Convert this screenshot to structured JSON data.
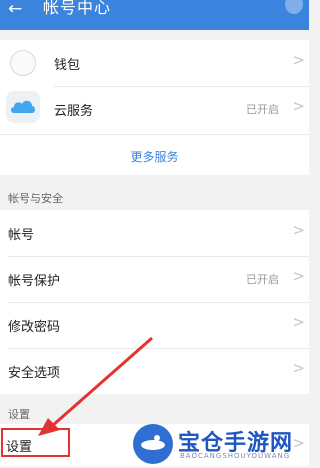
{
  "header": {
    "back_icon": "←",
    "title": "帐号中心"
  },
  "services": {
    "items": [
      {
        "label": "钱包",
        "status": "",
        "icon": "wallet-icon"
      },
      {
        "label": "云服务",
        "status": "已开启",
        "icon": "cloud-icon"
      }
    ],
    "more_label": "更多服务"
  },
  "account_security": {
    "section_title": "帐号与安全",
    "items": [
      {
        "label": "帐号",
        "status": ""
      },
      {
        "label": "帐号保护",
        "status": "已开启"
      },
      {
        "label": "修改密码",
        "status": ""
      },
      {
        "label": "安全选项",
        "status": ""
      }
    ]
  },
  "settings": {
    "section_title": "设置",
    "items": [
      {
        "label": "设置",
        "status": ""
      }
    ]
  },
  "chevron": ">",
  "watermark": {
    "title": "宝仓手游网",
    "subtitle": "BAOCANGSHOUYOUWANG"
  },
  "colors": {
    "accent": "#3b84de",
    "highlight": "#e23232"
  }
}
